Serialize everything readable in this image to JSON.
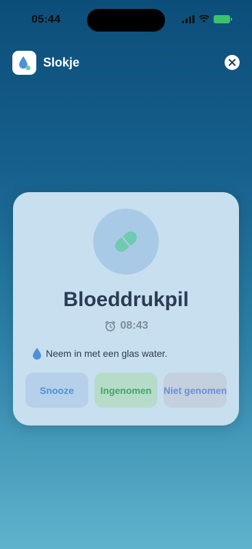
{
  "status": {
    "time": "05:44"
  },
  "app": {
    "name": "Slokje"
  },
  "card": {
    "title": "Bloeddrukpil",
    "time": "08:43",
    "note": "Neem in met een glas water."
  },
  "actions": {
    "snooze": "Snooze",
    "taken": "Ingenomen",
    "not_taken": "Niet genomen"
  },
  "colors": {
    "accent_blue": "#4f8fd6",
    "accent_green": "#3ea564",
    "pill": "#6fcab0"
  }
}
